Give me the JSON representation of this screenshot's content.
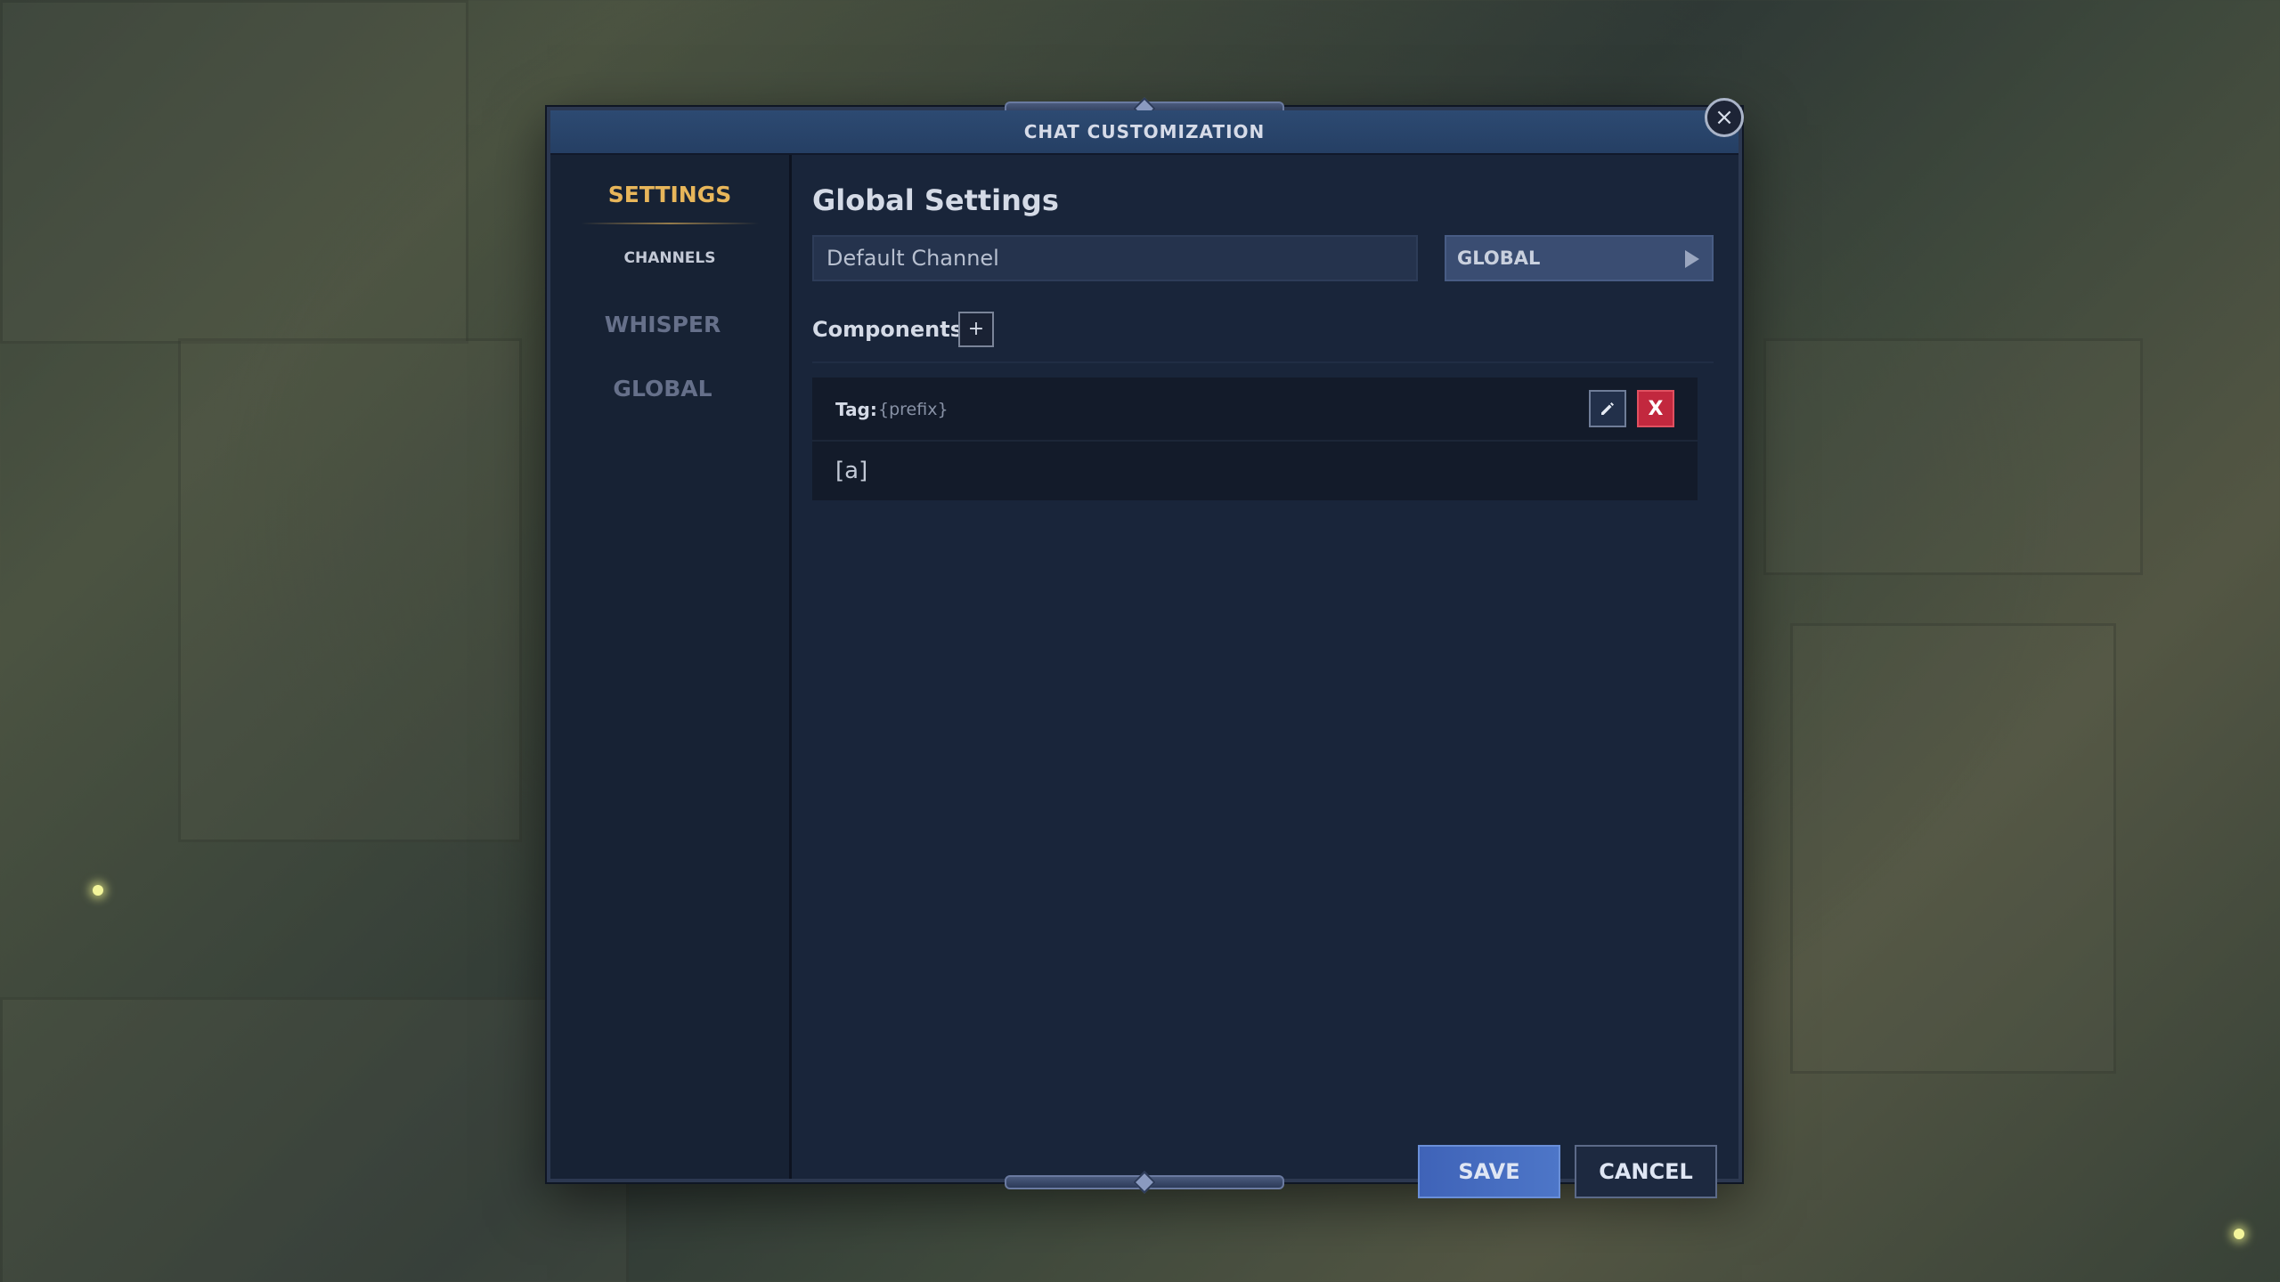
{
  "dialog": {
    "title": "CHAT CUSTOMIZATION",
    "close_icon": "close-icon"
  },
  "sidebar": {
    "items": [
      {
        "label": "SETTINGS",
        "active": true
      },
      {
        "label": "CHANNELS",
        "active": false
      },
      {
        "label": "WHISPER",
        "active": false
      },
      {
        "label": "GLOBAL",
        "active": false
      }
    ]
  },
  "main": {
    "heading": "Global Settings",
    "default_channel": {
      "label": "Default Channel",
      "selected": "GLOBAL",
      "arrow_icon": "triangle-right-icon"
    },
    "components": {
      "label": "Components",
      "add_label": "+",
      "items": [
        {
          "tag_label": "Tag:",
          "tag_value": "{prefix}",
          "value": "[a]",
          "edit_icon": "pencil-icon",
          "delete_label": "X"
        }
      ]
    }
  },
  "actions": {
    "save_label": "SAVE",
    "cancel_label": "CANCEL"
  },
  "colors": {
    "accent_gold": "#e8b65a",
    "save_blue": "#4d76c8",
    "delete_red": "#c2283e",
    "panel_bg": "#19253a"
  }
}
